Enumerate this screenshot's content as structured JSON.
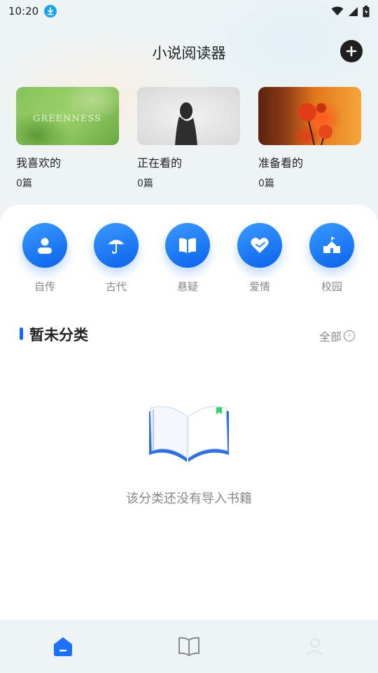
{
  "status_bar": {
    "time": "10:20",
    "icons": [
      "download-icon",
      "wifi-icon",
      "signal-icon",
      "battery-icon"
    ]
  },
  "header": {
    "title": "小说阅读器",
    "add_icon": "plus-icon"
  },
  "collections": [
    {
      "label": "我喜欢的",
      "count": "0篇",
      "cover_text": "GREENNESS"
    },
    {
      "label": "正在看的",
      "count": "0篇"
    },
    {
      "label": "准备看的",
      "count": "0篇"
    }
  ],
  "categories": [
    {
      "label": "自传",
      "icon": "person-icon"
    },
    {
      "label": "古代",
      "icon": "umbrella-icon"
    },
    {
      "label": "悬疑",
      "icon": "book-icon"
    },
    {
      "label": "爱情",
      "icon": "heart-icon"
    },
    {
      "label": "校园",
      "icon": "school-icon"
    }
  ],
  "section": {
    "title": "暂未分类",
    "all_label": "全部"
  },
  "empty_state": {
    "message": "该分类还没有导入书籍"
  },
  "tabbar": {
    "tabs": [
      {
        "icon": "home-icon",
        "active": true
      },
      {
        "icon": "open-book-icon",
        "active": false
      },
      {
        "icon": "profile-icon",
        "active": false
      }
    ]
  },
  "colors": {
    "accent": "#1565ff",
    "icon_gradient_start": "#3a9bff",
    "icon_gradient_end": "#0a62ea"
  }
}
